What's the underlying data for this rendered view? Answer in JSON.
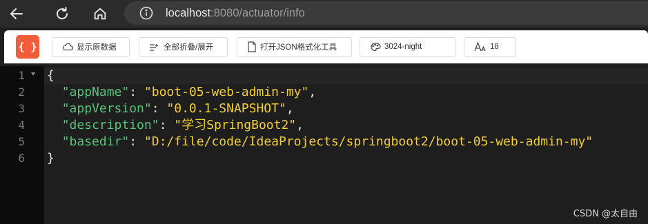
{
  "browser": {
    "url_host": "localhost",
    "url_rest": ":8080/actuator/info"
  },
  "toolbar": {
    "logo_text": "{ }",
    "raw_data_label": "显示原数据",
    "fold_label": "全部折叠/展开",
    "format_tool_label": "打开JSON格式化工具",
    "theme_value": "3024-night",
    "font_size_value": "18"
  },
  "editor": {
    "line_numbers": [
      "1",
      "2",
      "3",
      "4",
      "5",
      "6"
    ],
    "open_brace": "{",
    "close_brace": "}",
    "entries": [
      {
        "key": "\"appName\"",
        "value": "\"boot-05-web-admin-my\""
      },
      {
        "key": "\"appVersion\"",
        "value": "\"0.0.1-SNAPSHOT\""
      },
      {
        "key": "\"description\"",
        "value": "\"学习SpringBoot2\""
      },
      {
        "key": "\"basedir\"",
        "value": "\"D:/file/code/IdeaProjects/springboot2/boot-05-web-admin-my\""
      }
    ]
  },
  "watermark": "CSDN @太自由",
  "colors": {
    "key": "#59c27a",
    "string": "#f2cf2e",
    "background": "#1e1e1e",
    "logo": "#f25c3b"
  }
}
